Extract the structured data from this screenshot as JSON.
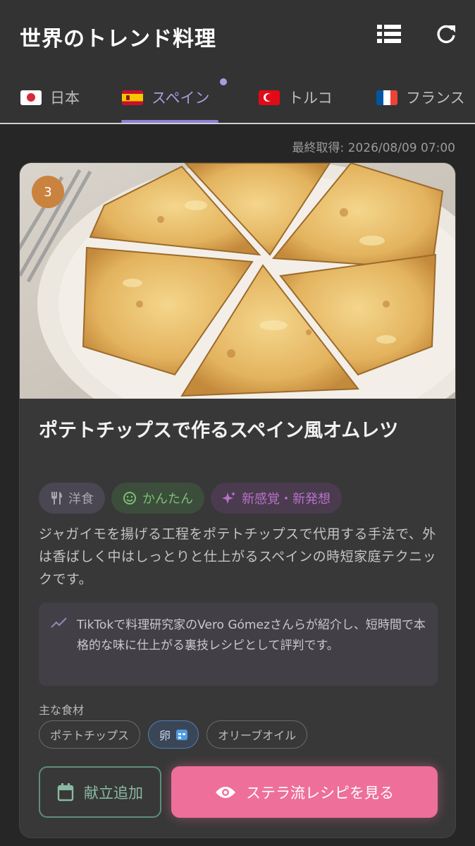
{
  "app": {
    "title": "世界のトレンド料理"
  },
  "header": {
    "list_icon": "list-icon",
    "refresh_icon": "refresh-icon"
  },
  "tabs": [
    {
      "label": "日本",
      "flag": "jp-flag-icon"
    },
    {
      "label": "スペイン",
      "flag": "es-flag-icon",
      "active": true
    },
    {
      "label": "トルコ",
      "flag": "tr-flag-icon"
    },
    {
      "label": "フランス",
      "flag": "fr-flag-icon"
    }
  ],
  "status": {
    "last_fetched": "最終取得: 2026/08/09 07:00"
  },
  "card": {
    "rank": "3",
    "title": "ポテトチップスで作るスペイン風オムレツ",
    "tags": [
      {
        "label": "洋食",
        "icon": "utensils-icon"
      },
      {
        "label": "かんたん",
        "icon": "smile-icon"
      },
      {
        "label": "新感覚・新発想",
        "icon": "sparkle-icon"
      }
    ],
    "description": "ジャガイモを揚げる工程をポテトチップスで代用する手法で、外は香ばしく中はしっとりと仕上がるスペインの時短家庭テクニックです。",
    "trend_note": "TikTokで料理研究家のVero Gómezさんらが紹介し、短時間で本格的な味に仕上がる裏技レシピとして評判です。",
    "ingredients_label": "主な食材",
    "ingredients": [
      "ポテトチップス",
      "卵",
      "オリーブオイル"
    ],
    "buttons": {
      "add_plan": "献立追加",
      "view_recipe": "ステラ流レシピを見る"
    }
  },
  "colors": {
    "accent": "#8f80d6",
    "rank_badge": "#c9833e",
    "primary_button": "#ee6f9a",
    "secondary_button": "#5f8f78"
  }
}
